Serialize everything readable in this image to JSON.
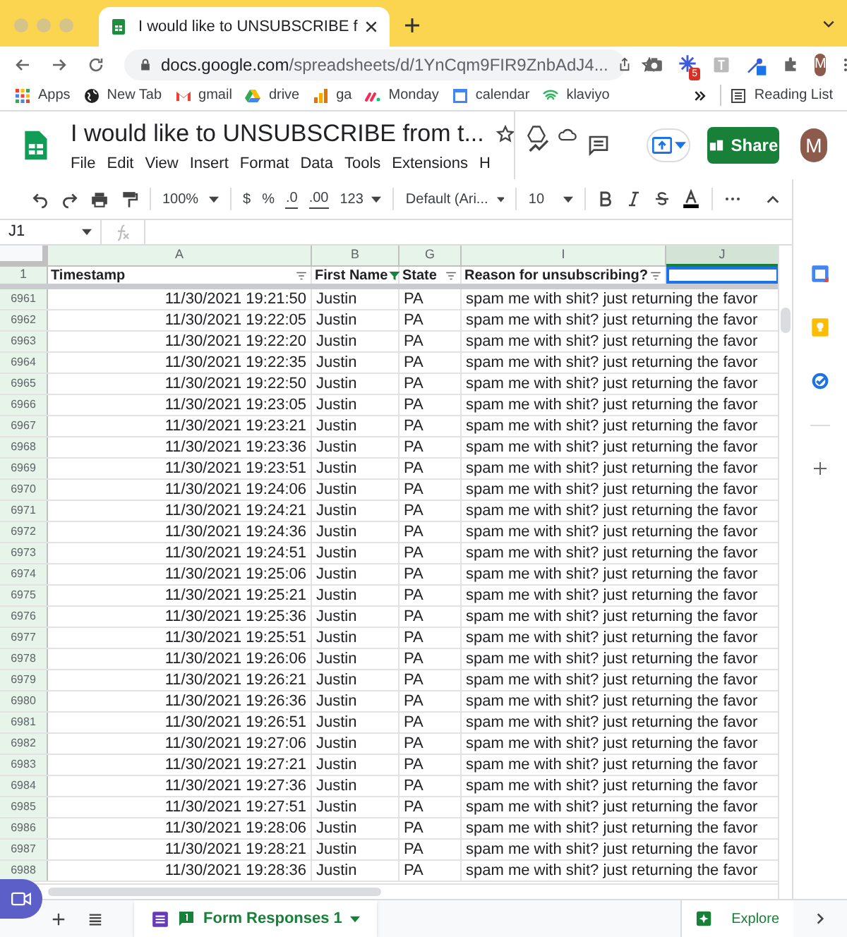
{
  "browser": {
    "tab_title": "I would like to UNSUBSCRIBE f",
    "url_host": "docs.google.com",
    "url_path": "/spreadsheets/d/1YnCqm9FIR9ZnbAdJ4...",
    "extension_badge": "5",
    "profile_initial": "M",
    "bookmarks": [
      "Apps",
      "New Tab",
      "gmail",
      "drive",
      "ga",
      "Monday",
      "calendar",
      "klaviyo"
    ],
    "reading_list": "Reading List"
  },
  "doc": {
    "title": "I would like to UNSUBSCRIBE  from t...",
    "menus": [
      "File",
      "Edit",
      "View",
      "Insert",
      "Format",
      "Data",
      "Tools",
      "Extensions",
      "H"
    ],
    "share": "Share",
    "avatar": "M"
  },
  "toolbar": {
    "zoom": "100%",
    "currency": "$",
    "percent": "%",
    "decrease_decimal": ".0",
    "increase_decimal": ".00",
    "more_formats": "123",
    "font": "Default (Ari...",
    "font_size": "10"
  },
  "name_box": "J1",
  "columns": [
    {
      "letter": "A",
      "header": "Timestamp",
      "filtered": false,
      "selected": false
    },
    {
      "letter": "B",
      "header": "First Name",
      "filtered": true,
      "selected": false
    },
    {
      "letter": "G",
      "header": "State",
      "filtered": false,
      "selected": false
    },
    {
      "letter": "I",
      "header": "Reason for unsubscribing?",
      "filtered": false,
      "selected": false
    },
    {
      "letter": "J",
      "selected": true
    }
  ],
  "header_row": "1",
  "rows": [
    {
      "num": "6961",
      "cells": [
        "11/30/2021 19:21:50",
        "Justin",
        "PA",
        "spam me with shit? just returning the favor"
      ]
    },
    {
      "num": "6962",
      "cells": [
        "11/30/2021 19:22:05",
        "Justin",
        "PA",
        "spam me with shit? just returning the favor"
      ]
    },
    {
      "num": "6963",
      "cells": [
        "11/30/2021 19:22:20",
        "Justin",
        "PA",
        "spam me with shit? just returning the favor"
      ]
    },
    {
      "num": "6964",
      "cells": [
        "11/30/2021 19:22:35",
        "Justin",
        "PA",
        "spam me with shit? just returning the favor"
      ]
    },
    {
      "num": "6965",
      "cells": [
        "11/30/2021 19:22:50",
        "Justin",
        "PA",
        "spam me with shit? just returning the favor"
      ]
    },
    {
      "num": "6966",
      "cells": [
        "11/30/2021 19:23:05",
        "Justin",
        "PA",
        "spam me with shit? just returning the favor"
      ]
    },
    {
      "num": "6967",
      "cells": [
        "11/30/2021 19:23:21",
        "Justin",
        "PA",
        "spam me with shit? just returning the favor"
      ]
    },
    {
      "num": "6968",
      "cells": [
        "11/30/2021 19:23:36",
        "Justin",
        "PA",
        "spam me with shit? just returning the favor"
      ]
    },
    {
      "num": "6969",
      "cells": [
        "11/30/2021 19:23:51",
        "Justin",
        "PA",
        "spam me with shit? just returning the favor"
      ]
    },
    {
      "num": "6970",
      "cells": [
        "11/30/2021 19:24:06",
        "Justin",
        "PA",
        "spam me with shit? just returning the favor"
      ]
    },
    {
      "num": "6971",
      "cells": [
        "11/30/2021 19:24:21",
        "Justin",
        "PA",
        "spam me with shit? just returning the favor"
      ]
    },
    {
      "num": "6972",
      "cells": [
        "11/30/2021 19:24:36",
        "Justin",
        "PA",
        "spam me with shit? just returning the favor"
      ]
    },
    {
      "num": "6973",
      "cells": [
        "11/30/2021 19:24:51",
        "Justin",
        "PA",
        "spam me with shit? just returning the favor"
      ]
    },
    {
      "num": "6974",
      "cells": [
        "11/30/2021 19:25:06",
        "Justin",
        "PA",
        "spam me with shit? just returning the favor"
      ]
    },
    {
      "num": "6975",
      "cells": [
        "11/30/2021 19:25:21",
        "Justin",
        "PA",
        "spam me with shit? just returning the favor"
      ]
    },
    {
      "num": "6976",
      "cells": [
        "11/30/2021 19:25:36",
        "Justin",
        "PA",
        "spam me with shit? just returning the favor"
      ]
    },
    {
      "num": "6977",
      "cells": [
        "11/30/2021 19:25:51",
        "Justin",
        "PA",
        "spam me with shit? just returning the favor"
      ]
    },
    {
      "num": "6978",
      "cells": [
        "11/30/2021 19:26:06",
        "Justin",
        "PA",
        "spam me with shit? just returning the favor"
      ]
    },
    {
      "num": "6979",
      "cells": [
        "11/30/2021 19:26:21",
        "Justin",
        "PA",
        "spam me with shit? just returning the favor"
      ]
    },
    {
      "num": "6980",
      "cells": [
        "11/30/2021 19:26:36",
        "Justin",
        "PA",
        "spam me with shit? just returning the favor"
      ]
    },
    {
      "num": "6981",
      "cells": [
        "11/30/2021 19:26:51",
        "Justin",
        "PA",
        "spam me with shit? just returning the favor"
      ]
    },
    {
      "num": "6982",
      "cells": [
        "11/30/2021 19:27:06",
        "Justin",
        "PA",
        "spam me with shit? just returning the favor"
      ]
    },
    {
      "num": "6983",
      "cells": [
        "11/30/2021 19:27:21",
        "Justin",
        "PA",
        "spam me with shit? just returning the favor"
      ]
    },
    {
      "num": "6984",
      "cells": [
        "11/30/2021 19:27:36",
        "Justin",
        "PA",
        "spam me with shit? just returning the favor"
      ]
    },
    {
      "num": "6985",
      "cells": [
        "11/30/2021 19:27:51",
        "Justin",
        "PA",
        "spam me with shit? just returning the favor"
      ]
    },
    {
      "num": "6986",
      "cells": [
        "11/30/2021 19:28:06",
        "Justin",
        "PA",
        "spam me with shit? just returning the favor"
      ]
    },
    {
      "num": "6987",
      "cells": [
        "11/30/2021 19:28:21",
        "Justin",
        "PA",
        "spam me with shit? just returning the favor"
      ]
    },
    {
      "num": "6988",
      "cells": [
        "11/30/2021 19:28:36",
        "Justin",
        "PA",
        "spam me with shit? just returning the favor"
      ]
    }
  ],
  "sheet_tabs": [
    {
      "label": "Form Responses 1",
      "selected": true
    }
  ],
  "explore": "Explore"
}
